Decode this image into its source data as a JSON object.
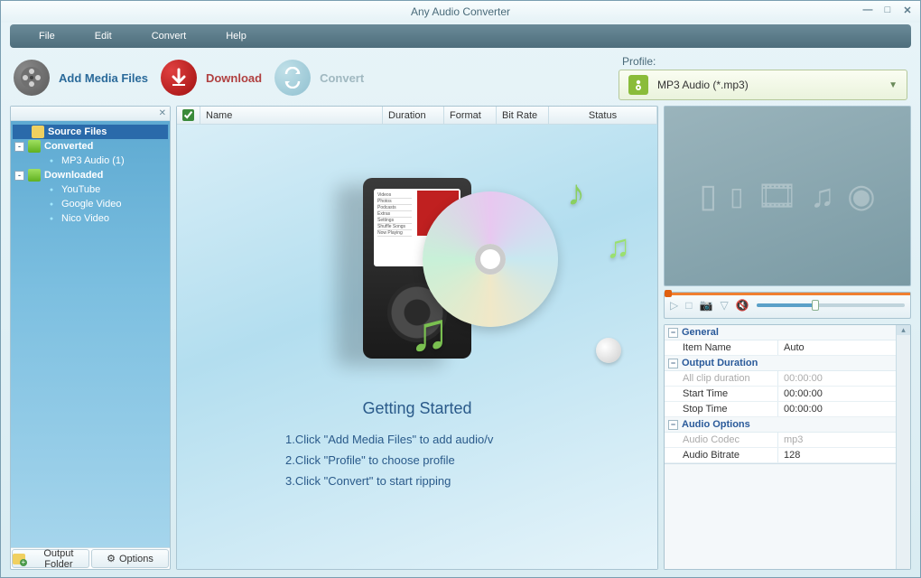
{
  "window": {
    "title": "Any Audio Converter"
  },
  "menu": {
    "file": "File",
    "edit": "Edit",
    "convert": "Convert",
    "help": "Help"
  },
  "toolbar": {
    "add_media": "Add Media Files",
    "download": "Download",
    "convert": "Convert"
  },
  "profile": {
    "label": "Profile:",
    "selected": "MP3 Audio (*.mp3)"
  },
  "sidebar": {
    "items": [
      {
        "label": "Source Files",
        "level": 0,
        "icon": "folder",
        "selected": true,
        "bold": true
      },
      {
        "label": "Converted",
        "level": 0,
        "icon": "folder-green",
        "toggle": "-",
        "bold": true
      },
      {
        "label": "MP3 Audio (1)",
        "level": 1,
        "icon": "dot"
      },
      {
        "label": "Downloaded",
        "level": 0,
        "icon": "folder-green",
        "toggle": "-",
        "bold": true
      },
      {
        "label": "YouTube",
        "level": 1,
        "icon": "dot"
      },
      {
        "label": "Google Video",
        "level": 1,
        "icon": "dot"
      },
      {
        "label": "Nico Video",
        "level": 1,
        "icon": "dot"
      }
    ],
    "footer": {
      "output_folder": "Output Folder",
      "options": "Options"
    }
  },
  "list_headers": {
    "name": "Name",
    "duration": "Duration",
    "format": "Format",
    "bitrate": "Bit Rate",
    "status": "Status"
  },
  "getting_started": {
    "title": "Getting Started",
    "step1": "1.Click \"Add Media Files\" to add audio/v",
    "step2": "2.Click \"Profile\" to choose profile",
    "step3": "3.Click \"Convert\" to start ripping"
  },
  "props": {
    "sections": {
      "general": "General",
      "output_duration": "Output Duration",
      "audio_options": "Audio Options"
    },
    "rows": {
      "item_name": {
        "key": "Item Name",
        "val": "Auto"
      },
      "all_clip": {
        "key": "All clip duration",
        "val": "00:00:00",
        "disabled": true
      },
      "start_time": {
        "key": "Start Time",
        "val": "00:00:00"
      },
      "stop_time": {
        "key": "Stop Time",
        "val": "00:00:00"
      },
      "audio_codec": {
        "key": "Audio Codec",
        "val": "mp3",
        "disabled": true
      },
      "audio_bitrate": {
        "key": "Audio Bitrate",
        "val": "128"
      }
    }
  }
}
